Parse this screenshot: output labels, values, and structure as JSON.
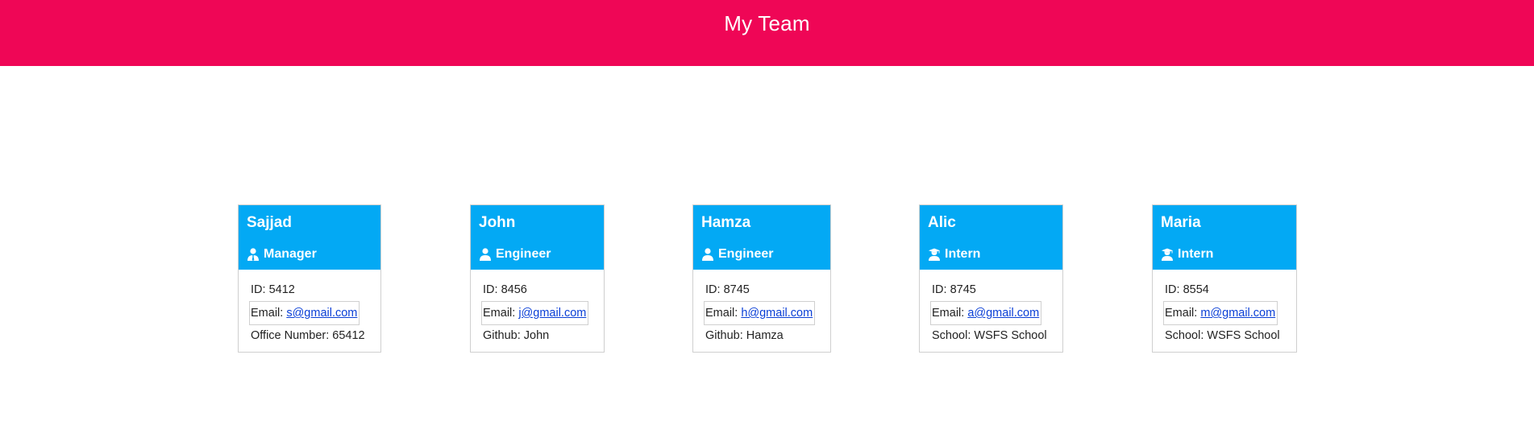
{
  "header": {
    "title": "My Team"
  },
  "labels": {
    "id": "ID:",
    "email": "Email:",
    "office": "Office Number:",
    "github": "Github:",
    "school": "School:"
  },
  "colors": {
    "header_bg": "#ef0656",
    "card_head_bg": "#03a9f4",
    "link": "#0a3fd6"
  },
  "employees": [
    {
      "name": "Sajjad",
      "role": "Manager",
      "role_icon": "user-tie-icon",
      "id": "5412",
      "email": "s@gmail.com",
      "extra_label": "Office Number:",
      "extra_value": "65412"
    },
    {
      "name": "John",
      "role": "Engineer",
      "role_icon": "user-icon",
      "id": "8456",
      "email": "j@gmail.com",
      "extra_label": "Github:",
      "extra_value": "John"
    },
    {
      "name": "Hamza",
      "role": "Engineer",
      "role_icon": "user-icon",
      "id": "8745",
      "email": "h@gmail.com",
      "extra_label": "Github:",
      "extra_value": "Hamza"
    },
    {
      "name": "Alic",
      "role": "Intern",
      "role_icon": "user-graduate-icon",
      "id": "8745",
      "email": "a@gmail.com",
      "extra_label": "School:",
      "extra_value": "WSFS School"
    },
    {
      "name": "Maria",
      "role": "Intern",
      "role_icon": "user-graduate-icon",
      "id": "8554",
      "email": "m@gmail.com",
      "extra_label": "School:",
      "extra_value": "WSFS School"
    }
  ]
}
